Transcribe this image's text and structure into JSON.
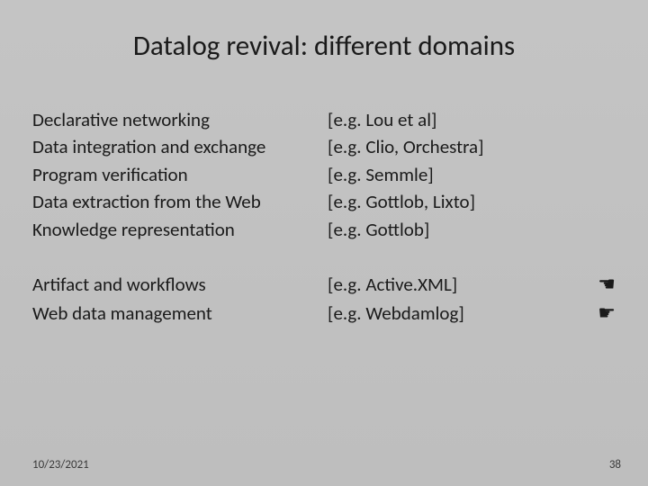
{
  "title": "Datalog revival: different domains",
  "group1": [
    {
      "topic": "Declarative networking",
      "ref": "[e.g. Lou et al]"
    },
    {
      "topic": "Data integration and exchange",
      "ref": "[e.g. Clio, Orchestra]"
    },
    {
      "topic": "Program verification",
      "ref": "[e.g. Semmle]"
    },
    {
      "topic": "Data extraction from the Web",
      "ref": "[e.g. Gottlob, Lixto]"
    },
    {
      "topic": "Knowledge representation",
      "ref": "[e.g. Gottlob]"
    }
  ],
  "group2": [
    {
      "topic": "Artifact and workflows",
      "ref": "[e.g. Active.XML]",
      "pointer": "☚"
    },
    {
      "topic": "Web data management",
      "ref": "[e.g. Webdamlog]",
      "pointer": "☛"
    }
  ],
  "footer": {
    "date": "10/23/2021",
    "page": "38"
  }
}
